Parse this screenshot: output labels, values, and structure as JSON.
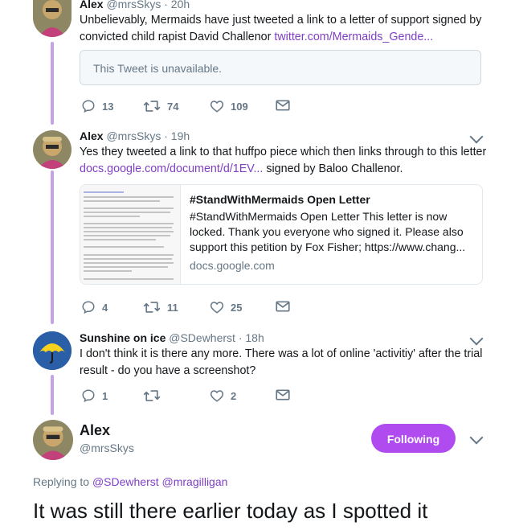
{
  "tweets": [
    {
      "name": "Alex",
      "handle": "@mrsSkys",
      "time": "· 20h",
      "text_prefix": "Unbelievably, Mermaids have just tweeted a link to a letter of support signed by convicted child rapist David Challenor ",
      "link": "twitter.com/Mermaids_Gende...",
      "unavailable": "This Tweet is unavailable.",
      "replies": "13",
      "retweets": "74",
      "likes": "109"
    },
    {
      "name": "Alex",
      "handle": "@mrsSkys",
      "time": "· 19h",
      "text_prefix": "Yes they tweeted a link to that huffpo piece which then links through to this letter ",
      "link": "docs.google.com/document/d/1EV...",
      "text_suffix": " signed by Baloo Challenor.",
      "card": {
        "title": "#StandWithMermaids Open Letter",
        "description": "#StandWithMermaids Open Letter This letter is now locked. Thank you everyone who signed it. Please also support this petition by Fox Fisher; https://www.chang...",
        "domain": "docs.google.com"
      },
      "replies": "4",
      "retweets": "11",
      "likes": "25"
    },
    {
      "name": "Sunshine on ice",
      "handle": "@SDewherst",
      "time": "· 18h",
      "text": "I don't think it is there any more.  There was a lot of online 'activitiy' after the trial result - do you have a screenshot?",
      "replies": "1",
      "retweets": "",
      "likes": "2"
    }
  ],
  "main_tweet": {
    "name": "Alex",
    "handle": "@mrsSkys",
    "follow_label": "Following",
    "replying_label": "Replying to",
    "replying_to": "@SDewherst @mragilligan",
    "text": "It was still there earlier today as I spotted it"
  },
  "colors": {
    "accent": "#b04bf0",
    "link": "#7f3fc7",
    "thread_line": "#c5a3e8",
    "muted": "#657786"
  },
  "icons": [
    "reply-icon",
    "retweet-icon",
    "like-icon",
    "message-icon",
    "chevron-down-icon",
    "umbrella-avatar-icon"
  ]
}
